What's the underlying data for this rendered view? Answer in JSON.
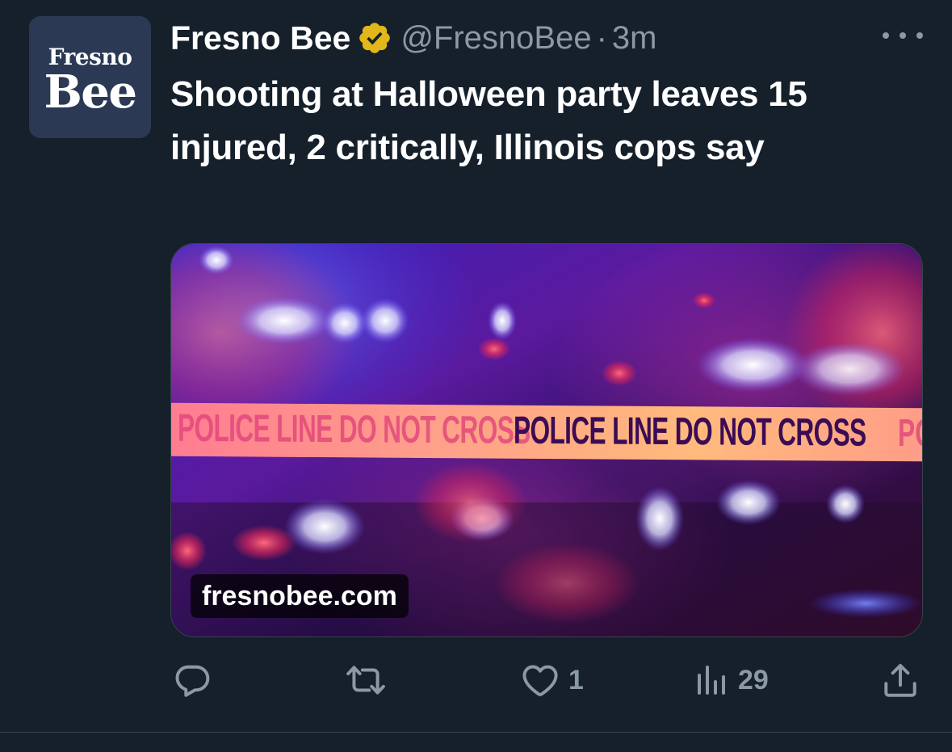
{
  "author": {
    "avatar_line1": "Fresno",
    "avatar_line2": "Bee",
    "name": "Fresno Bee",
    "handle": "@FresnoBee",
    "separator": "·",
    "time": "3m",
    "verified_color": "#e2b719"
  },
  "tweet": {
    "text": "Shooting at Halloween party leaves 15 injured, 2 critically, Illinois cops say"
  },
  "card": {
    "domain": "fresnobee.com",
    "tape_text_1": "POLICE LINE DO NOT CROSS",
    "tape_text_2": "POLICE LINE DO NOT CROSS",
    "tape_text_3": "PO"
  },
  "actions": {
    "reply_count": "",
    "retweet_count": "",
    "like_count": "1",
    "views_count": "29"
  },
  "icons": {
    "more": "more-icon",
    "reply": "reply-icon",
    "retweet": "retweet-icon",
    "like": "heart-icon",
    "views": "views-icon",
    "share": "share-icon",
    "verified": "verified-badge-icon"
  },
  "colors": {
    "background": "#15202b",
    "secondary_text": "#8b98a5",
    "avatar_bg": "#2b3954"
  }
}
